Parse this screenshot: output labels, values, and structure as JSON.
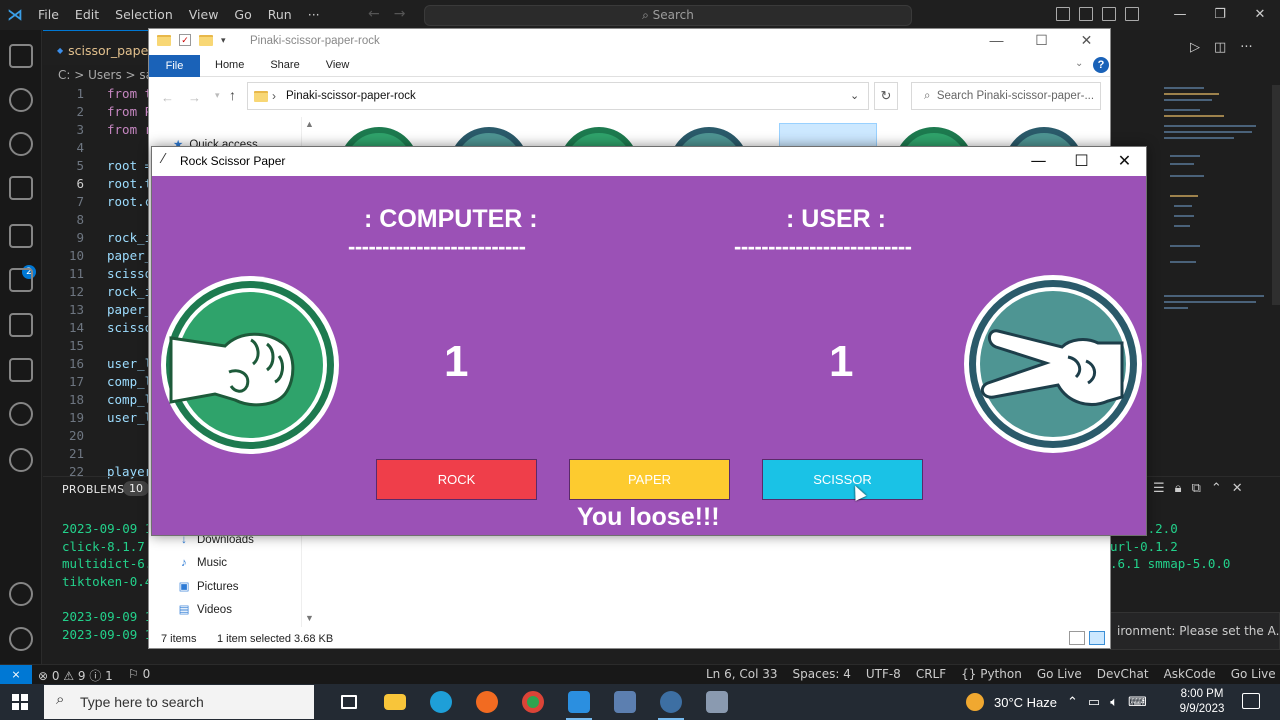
{
  "vscode": {
    "menu": [
      "File",
      "Edit",
      "Selection",
      "View",
      "Go",
      "Run",
      "···"
    ],
    "search_label": "Search",
    "tab_label": "scissor_paper",
    "breadcrumb": "C: > Users > sas",
    "extensions_badge": "2",
    "line_numbers": [
      "1",
      "2",
      "3",
      "4",
      "5",
      "6",
      "7",
      "8",
      "9",
      "10",
      "11",
      "12",
      "13",
      "14",
      "15",
      "16",
      "17",
      "18",
      "19",
      "20",
      "21",
      "22"
    ],
    "active_line": "6",
    "code_lines": [
      "from t",
      "from P",
      "from r",
      "",
      "root =",
      "root.t",
      "root.c",
      "",
      "rock_i",
      "paper_",
      "scisso",
      "rock_i",
      "paper_",
      "scisso",
      "",
      "user_l",
      "comp_l",
      "comp_l",
      "user_l",
      "",
      "",
      "player"
    ],
    "panel_label": "PROBLEMS",
    "problems_count": "10",
    "terminal_left": [
      "2023-09-09 1",
      "click-8.1.7",
      "multidict-6.",
      "tiktoken-0.4",
      "",
      "2023-09-09 1",
      "2023-09-09 1"
    ],
    "terminal_right": [
      "zer-3.2.0",
      "url-0.1.2",
      ".6.1 smmap-5.0.0"
    ],
    "notification_text": "ironment: Please set the A...",
    "status": {
      "remote": "⨯",
      "errors": "⊗ 0 ⚠ 9 ⓘ 1",
      "ports": "⚐ 0",
      "position": "Ln 6, Col 33",
      "spaces": "Spaces: 4",
      "encoding": "UTF-8",
      "eol": "CRLF",
      "language": "{} Python",
      "golive1": "Go Live",
      "devchat": "DevChat",
      "askcode": "AskCode",
      "golive2": "Go Live"
    }
  },
  "explorer": {
    "title": "Pinaki-scissor-paper-rock",
    "ribbon_file": "File",
    "ribbon_tabs": [
      "Home",
      "Share",
      "View"
    ],
    "address": "Pinaki-scissor-paper-rock",
    "search_placeholder": "Search Pinaki-scissor-paper-...",
    "quick_access": "Quick access",
    "nav_items": [
      {
        "label": "Downloads",
        "icon": "↓"
      },
      {
        "label": "Music",
        "icon": "♪"
      },
      {
        "label": "Pictures",
        "icon": "▣"
      },
      {
        "label": "Videos",
        "icon": "▤"
      }
    ],
    "item_count": "7 items",
    "selection_info": "1 item selected  3.68 KB"
  },
  "game": {
    "window_title": "Rock Scissor Paper",
    "computer_label": ": COMPUTER :",
    "user_label": ": USER :",
    "computer_dashes": "--------------------------",
    "user_dashes": "--------------------------",
    "computer_score": "1",
    "user_score": "1",
    "computer_choice": "rock",
    "user_choice": "scissor",
    "buttons": {
      "rock": "ROCK",
      "paper": "PAPER",
      "scissor": "SCISSOR"
    },
    "result": "You loose!!!",
    "colors": {
      "background": "#9b51b6",
      "rock_button": "#ef3e4a",
      "paper_button": "#fdcb2f",
      "scissor_button": "#1ac2e6"
    }
  },
  "taskbar": {
    "search_placeholder": "Type here to search",
    "weather": "30°C  Haze",
    "time": "8:00 PM",
    "date": "9/9/2023"
  }
}
